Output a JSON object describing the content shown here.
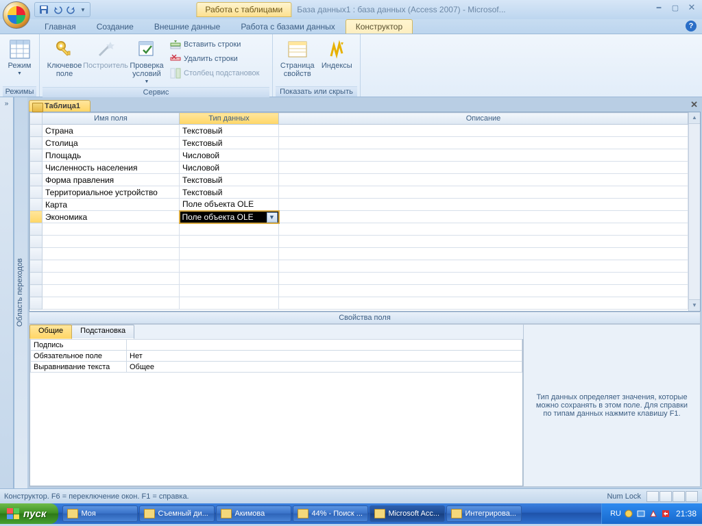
{
  "title": {
    "context_tab": "Работа с таблицами",
    "window_title": "База данных1 : база данных (Access 2007) - Microsof..."
  },
  "tabs": {
    "home": "Главная",
    "create": "Создание",
    "external": "Внешние данные",
    "dbtools": "Работа с базами данных",
    "design": "Конструктор"
  },
  "ribbon": {
    "views": {
      "mode": "Режим",
      "group": "Режимы"
    },
    "tools": {
      "key": "Ключевое поле",
      "builder": "Построитель",
      "validate": "Проверка условий",
      "insert_rows": "Вставить строки",
      "delete_rows": "Удалить строки",
      "lookup_col": "Столбец подстановок",
      "group": "Сервис"
    },
    "showhide": {
      "propsheet": "Страница свойств",
      "indexes": "Индексы",
      "group": "Показать или скрыть"
    }
  },
  "nav": {
    "pane_label": "Область переходов"
  },
  "doc": {
    "tab": "Таблица1",
    "headers": {
      "name": "Имя поля",
      "type": "Тип данных",
      "desc": "Описание"
    },
    "rows": [
      {
        "name": "Страна",
        "type": "Текстовый"
      },
      {
        "name": "Столица",
        "type": "Текстовый"
      },
      {
        "name": "Площадь",
        "type": "Числовой"
      },
      {
        "name": "Численность населения",
        "type": "Числовой"
      },
      {
        "name": "Форма правления",
        "type": "Текстовый"
      },
      {
        "name": "Территориальное устройство",
        "type": "Текстовый"
      },
      {
        "name": "Карта",
        "type": "Поле объекта OLE"
      },
      {
        "name": "Экономика",
        "type": "Поле объекта OLE"
      }
    ]
  },
  "props": {
    "header": "Свойства поля",
    "tab_general": "Общие",
    "tab_lookup": "Подстановка",
    "rows": [
      {
        "k": "Подпись",
        "v": ""
      },
      {
        "k": "Обязательное поле",
        "v": "Нет"
      },
      {
        "k": "Выравнивание текста",
        "v": "Общее"
      }
    ],
    "help": "Тип данных определяет значения, которые можно сохранять в этом поле.  Для справки по типам данных нажмите клавишу F1."
  },
  "statusbar": {
    "left": "Конструктор.  F6 = переключение окон.  F1 = справка.",
    "numlock": "Num Lock"
  },
  "taskbar": {
    "start": "пуск",
    "items": [
      "Моя",
      "Съемный ди...",
      "Акимова",
      "44% - Поиск ...",
      "Microsoft Acc...",
      "Интегрирова..."
    ],
    "lang": "RU",
    "clock": "21:38"
  }
}
